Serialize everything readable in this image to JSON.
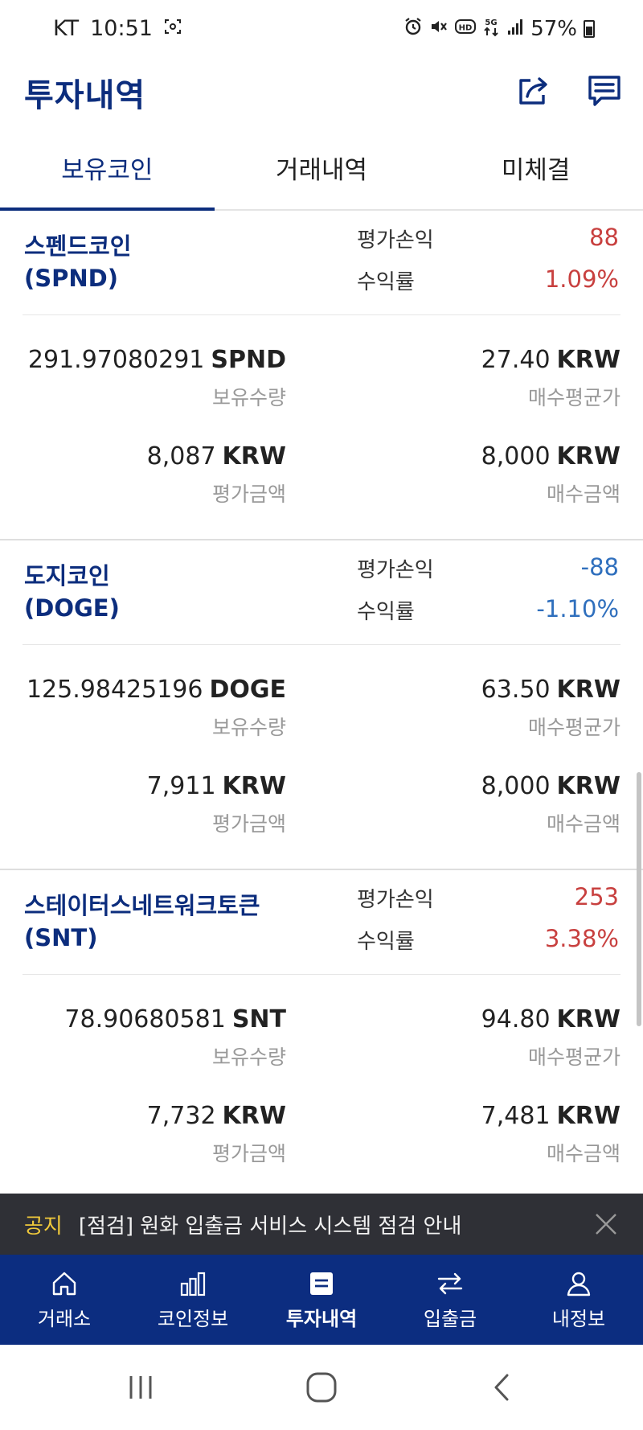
{
  "status_bar": {
    "carrier": "KT",
    "time": "10:51",
    "battery": "57%",
    "icons": [
      "screenshot-icon",
      "alarm-icon",
      "mute-icon",
      "hd-icon",
      "5g-icon",
      "signal-icon",
      "battery-icon"
    ]
  },
  "header": {
    "title": "투자내역",
    "icons": [
      "share-icon",
      "chat-icon"
    ]
  },
  "tabs": [
    {
      "label": "보유코인",
      "active": true
    },
    {
      "label": "거래내역",
      "active": false
    },
    {
      "label": "미체결",
      "active": false
    }
  ],
  "labels": {
    "pl": "평가손익",
    "rate": "수익률",
    "holding_qty": "보유수량",
    "avg_price": "매수평균가",
    "eval_amount": "평가금액",
    "buy_amount": "매수금액",
    "krw": "KRW"
  },
  "coins": [
    {
      "name": "스펜드코인",
      "symbol": "(SPND)",
      "ticker": "SPND",
      "pl": "88",
      "rate": "1.09%",
      "trend": "positive",
      "qty": "291.97080291",
      "avg_price": "27.40",
      "eval_amount": "8,087",
      "buy_amount": "8,000"
    },
    {
      "name": "도지코인",
      "symbol": "(DOGE)",
      "ticker": "DOGE",
      "pl": "-88",
      "rate": "-1.10%",
      "trend": "negative",
      "qty": "125.98425196",
      "avg_price": "63.50",
      "eval_amount": "7,911",
      "buy_amount": "8,000"
    },
    {
      "name": "스테이터스네트워크토큰",
      "symbol": "(SNT)",
      "ticker": "SNT",
      "pl": "253",
      "rate": "3.38%",
      "trend": "positive",
      "qty": "78.90680581",
      "avg_price": "94.80",
      "eval_amount": "7,732",
      "buy_amount": "7,481"
    }
  ],
  "notice": {
    "tag": "공지",
    "text": "[점검] 원화 입출금 서비스 시스템 점검 안내"
  },
  "bottom_nav": [
    {
      "label": "거래소",
      "icon": "home-icon",
      "active": false
    },
    {
      "label": "코인정보",
      "icon": "bar-chart-icon",
      "active": false
    },
    {
      "label": "투자내역",
      "icon": "list-icon",
      "active": true
    },
    {
      "label": "입출금",
      "icon": "transfer-icon",
      "active": false
    },
    {
      "label": "내정보",
      "icon": "user-icon",
      "active": false
    }
  ],
  "colors": {
    "brand": "#0c2d7d",
    "nav_bg": "#0c2d80",
    "positive": "#c8403f",
    "negative": "#2f6fbd",
    "notice_bg": "#2f3036",
    "notice_tag": "#f0c93b"
  }
}
